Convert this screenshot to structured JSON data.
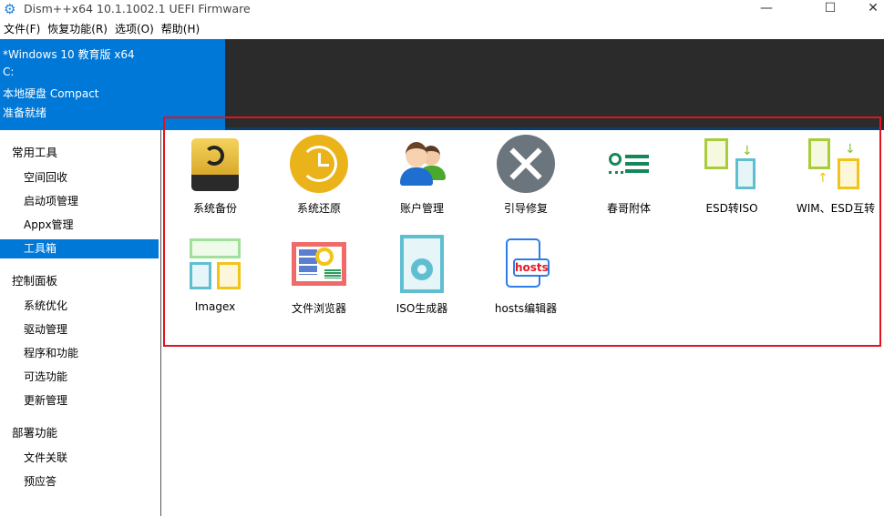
{
  "window": {
    "title": "Dism++x64 10.1.1002.1 UEFI Firmware",
    "minimize": "—",
    "maximize": "☐",
    "close": "✕"
  },
  "menu": [
    "文件(F)",
    "恢复功能(R)",
    "选项(O)",
    "帮助(H)"
  ],
  "header": {
    "lines": [
      "*Windows 10 教育版 x64",
      "C:",
      "本地硬盘 Compact",
      "准备就绪"
    ]
  },
  "sidebar": {
    "groups": [
      {
        "label": "常用工具",
        "items": [
          "空间回收",
          "启动项管理",
          "Appx管理",
          "工具箱"
        ]
      },
      {
        "label": "控制面板",
        "items": [
          "系统优化",
          "驱动管理",
          "程序和功能",
          "可选功能",
          "更新管理"
        ]
      },
      {
        "label": "部署功能",
        "items": [
          "文件关联",
          "预应答"
        ]
      }
    ],
    "selected": "工具箱"
  },
  "tools": [
    {
      "label": "系统备份",
      "icon": "drive-backup-icon"
    },
    {
      "label": "系统还原",
      "icon": "clock-restore-icon"
    },
    {
      "label": "账户管理",
      "icon": "users-icon"
    },
    {
      "label": "引导修复",
      "icon": "wrench-screwdriver-icon"
    },
    {
      "label": "春哥附体",
      "icon": "list-icon"
    },
    {
      "label": "ESD转ISO",
      "icon": "esd-iso-icon"
    },
    {
      "label": "WIM、ESD互转",
      "icon": "wim-esd-icon"
    },
    {
      "label": "Imagex",
      "icon": "imagex-icon"
    },
    {
      "label": "文件浏览器",
      "icon": "file-browser-icon"
    },
    {
      "label": "ISO生成器",
      "icon": "iso-disc-icon"
    },
    {
      "label": "hosts编辑器",
      "icon": "hosts-file-icon",
      "badge": "hosts"
    }
  ],
  "colors": {
    "accent": "#0078d7",
    "frame": "#e0141e",
    "header_dark": "#2b2b2b"
  }
}
